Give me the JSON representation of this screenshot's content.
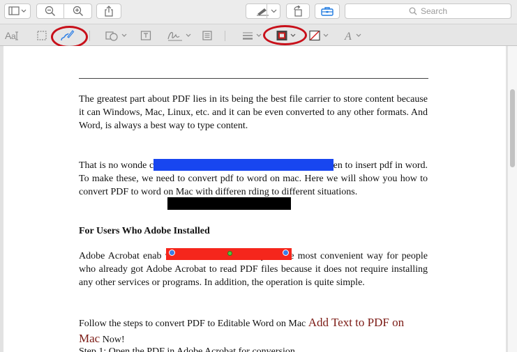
{
  "toolbar": {
    "search_placeholder": "Search",
    "icons": [
      "sidebar-icon",
      "zoom-out-icon",
      "zoom-in-icon",
      "share-icon",
      "pen-icon",
      "rotate-icon",
      "toolbox-icon",
      "search-icon"
    ]
  },
  "markup_toolbar": {
    "tools": [
      "text-style",
      "rectangle-select",
      "sketch",
      "shapes",
      "text-box",
      "sign",
      "note",
      "line-style",
      "border-color",
      "fill-color",
      "font"
    ],
    "highlighted": [
      "sketch",
      "border-color"
    ],
    "highlight_color": "#c8101a"
  },
  "document": {
    "para1": "The greatest part about PDF lies in its being the best file carrier to store content because it can                                                     Windows, Mac, Linux, etc. and it can be even converted to any other formats. And Word, is always a best way to type content.",
    "para2": "That is no wonde                                                                          changes on a pdf, open pdf in word on mac, even to insert pdf in word. To make these, we need to convert pdf to word on mac. Here we will show you how to convert PDF to word on Mac with differen                                                          rding to different situations.",
    "heading": "For Users Who Adobe Installed",
    "para3": "Adobe Acrobat enab                                                           word on mac and it may be the most convenient way for people who already got Adobe Acrobat to read PDF files because it does not require installing any other services or programs. In addition, the operation is quite simple.",
    "para4_start": "Follow the steps to convert PDF to Editable Word on Mac ",
    "para4_link": "Add Text to PDF on Mac",
    "para4_end": " Now!",
    "step1": "Step 1: Open the PDF in Adobe Acrobat for conversion."
  },
  "annotations": {
    "blue_box_color": "#1846f0",
    "black_box_color": "#000000",
    "red_box_color": "#f5261c"
  }
}
